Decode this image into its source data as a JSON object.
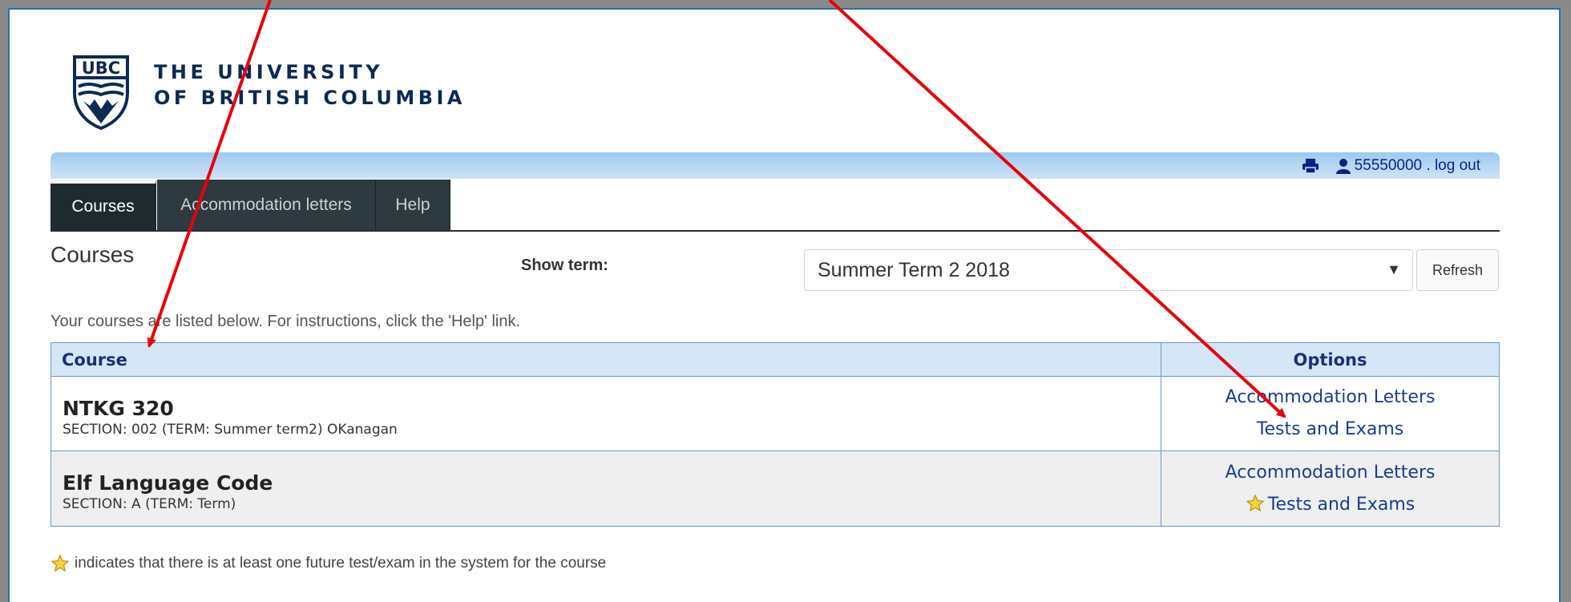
{
  "brand": {
    "line1": "THE UNIVERSITY",
    "line2": "OF BRITISH COLUMBIA",
    "crest_text": "UBC"
  },
  "topbar": {
    "print_icon": "printer-icon",
    "user_icon": "user-icon",
    "user_id": "55550000",
    "separator": " . ",
    "logout_label": "log out"
  },
  "nav": {
    "tabs": [
      {
        "label": "Courses",
        "active": true
      },
      {
        "label": "Accommodation letters",
        "active": false
      },
      {
        "label": "Help",
        "active": false
      }
    ]
  },
  "page": {
    "heading": "Courses",
    "term_label": "Show term:",
    "term_selected": "Summer Term 2 2018",
    "refresh_label": "Refresh",
    "intro": "Your courses are listed below. For instructions, click the 'Help' link."
  },
  "table": {
    "headers": {
      "course": "Course",
      "options": "Options"
    },
    "rows": [
      {
        "name": "NTKG 320",
        "section": "SECTION: 002 (TERM: Summer term2) OKanagan",
        "letters_link": "Accommodation Letters",
        "tests_link": "Tests and Exams",
        "star": false
      },
      {
        "name": "Elf Language Code",
        "section": "SECTION: A (TERM: Term)",
        "letters_link": "Accommodation Letters",
        "tests_link": "Tests and Exams",
        "star": true
      }
    ]
  },
  "legend": {
    "icon": "star-icon",
    "text": "indicates that there is at least one future test/exam in the system for the course"
  },
  "colors": {
    "accent": "#1a3d8f",
    "annotation": "#e8000b",
    "nav_bg": "#2d3a40",
    "header_bg": "#d5e6f7"
  }
}
